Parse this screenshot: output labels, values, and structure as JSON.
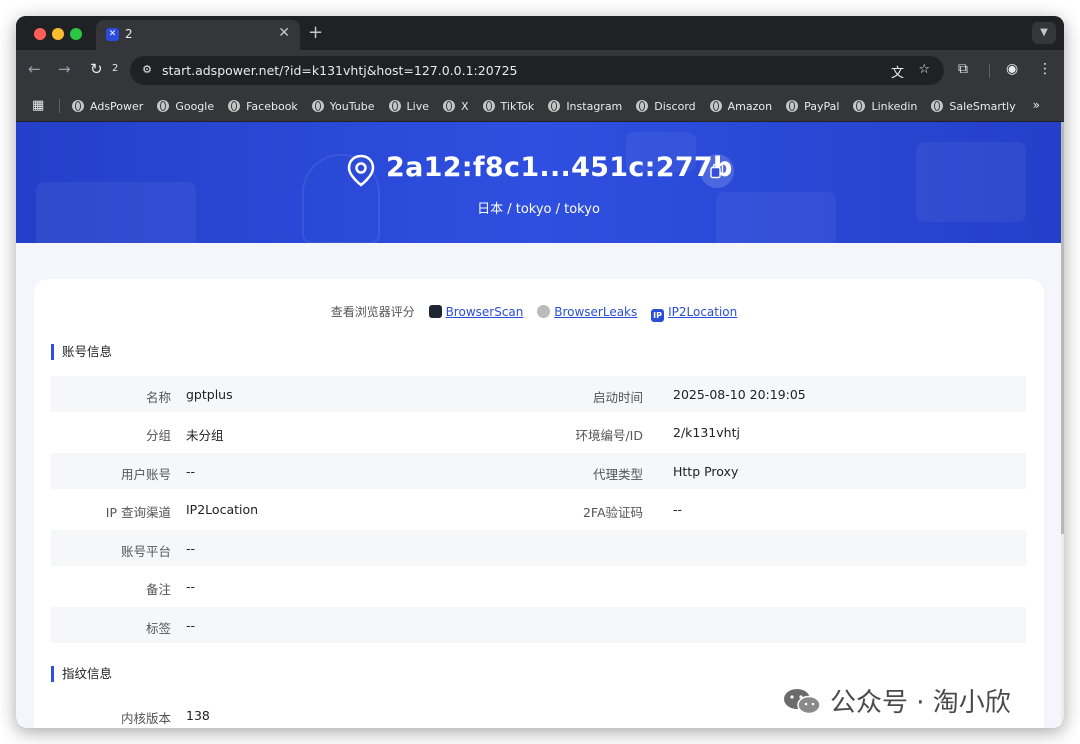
{
  "browser": {
    "tab": {
      "title": "2",
      "favicon_letter": "✕"
    },
    "url": "start.adspower.net/?id=k131vhtj&host=127.0.0.1:20725",
    "reload_count": "2",
    "bookmarks": [
      "AdsPower",
      "Google",
      "Facebook",
      "YouTube",
      "Live",
      "X",
      "TikTok",
      "Instagram",
      "Discord",
      "Amazon",
      "PayPal",
      "Linkedin",
      "SaleSmartly"
    ],
    "bookmarks_more": "»"
  },
  "hero": {
    "ip": "2a12:f8c1...451c:277b",
    "location": "日本 / tokyo / tokyo"
  },
  "score": {
    "label": "查看浏览器评分",
    "links": [
      "BrowserScan",
      "BrowserLeaks",
      "IP2Location"
    ]
  },
  "account_section": {
    "title": "账号信息",
    "rows": [
      {
        "k1": "名称",
        "v1": "gptplus",
        "k2": "启动时间",
        "v2": "2025-08-10 20:19:05"
      },
      {
        "k1": "分组",
        "v1": "未分组",
        "k2": "环境编号/ID",
        "v2": "2/k131vhtj"
      },
      {
        "k1": "用户账号",
        "v1": "--",
        "k2": "代理类型",
        "v2": "Http Proxy"
      },
      {
        "k1": "IP 查询渠道",
        "v1": "IP2Location",
        "k2": "2FA验证码",
        "v2": "--"
      },
      {
        "k1": "账号平台",
        "v1": "--",
        "k2": "",
        "v2": ""
      },
      {
        "k1": "备注",
        "v1": "--",
        "k2": "",
        "v2": ""
      },
      {
        "k1": "标签",
        "v1": "--",
        "k2": "",
        "v2": ""
      }
    ]
  },
  "fingerprint_section": {
    "title": "指纹信息",
    "rows": [
      {
        "k1": "内核版本",
        "v1": "138"
      }
    ]
  },
  "watermark": "公众号 · 淘小欣",
  "colors": {
    "hero": "#2f4fe0",
    "link": "#2a4fd6",
    "accent": "#2f4fe0"
  }
}
